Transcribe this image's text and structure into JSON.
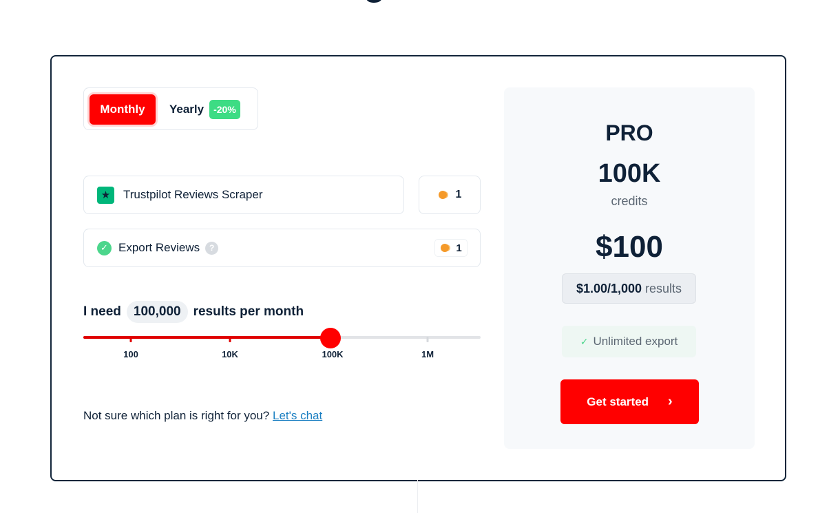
{
  "header": {
    "title_fragment": "g"
  },
  "billing_toggle": {
    "monthly_label": "Monthly",
    "yearly_label": "Yearly",
    "yearly_discount": "-20%",
    "selected": "Monthly"
  },
  "scraper": {
    "name": "Trustpilot Reviews Scraper",
    "icon": "trustpilot-star-icon",
    "credits": "1"
  },
  "addon": {
    "name": "Export Reviews",
    "icon": "check-circle-icon",
    "help_icon": "question-icon",
    "help_glyph": "?",
    "credits": "1"
  },
  "volume": {
    "prefix": "I need",
    "amount": "100,000",
    "suffix": "results per month",
    "slider": {
      "ticks": [
        "100",
        "10K",
        "100K",
        "1M"
      ],
      "selected_index": 2
    }
  },
  "help": {
    "text": "Not sure which plan is right for you?",
    "link": "Let's chat"
  },
  "plan": {
    "name": "PRO",
    "credits_amount": "100K",
    "credits_unit": "credits",
    "price": "$100",
    "rate_value": "$1.00/1,000",
    "rate_unit": "results",
    "feature": "Unlimited export",
    "cta_label": "Get started",
    "cta_icon": "chevron-right-icon"
  },
  "colors": {
    "accent": "#ff0000",
    "navy": "#0f2137",
    "green": "#3ddc84",
    "coin": "#f6a23a"
  }
}
